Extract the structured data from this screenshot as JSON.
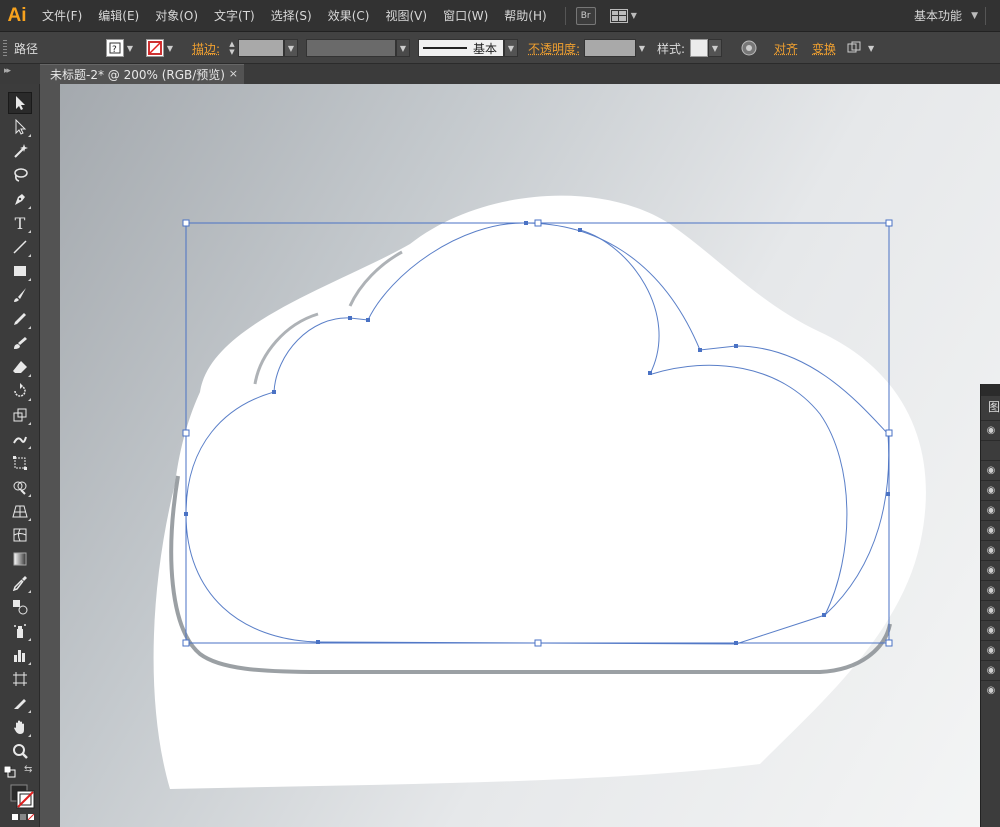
{
  "app": {
    "logo": "Ai"
  },
  "menu": {
    "items": [
      "文件(F)",
      "编辑(E)",
      "对象(O)",
      "文字(T)",
      "选择(S)",
      "效果(C)",
      "视图(V)",
      "窗口(W)",
      "帮助(H)"
    ],
    "bridge": "Br",
    "workspace": "基本功能"
  },
  "control": {
    "object_type": "路径",
    "fill_icon": "question-swatch-icon",
    "stroke_icon": "no-stroke-swatch-icon",
    "stroke_label": "描边:",
    "stroke_profile": "基本",
    "opacity_label": "不透明度:",
    "style_label": "样式:",
    "align_label": "对齐",
    "transform_label": "变换"
  },
  "document": {
    "tab_title": "未标题-2* @ 200% (RGB/预览)",
    "close_glyph": "×"
  },
  "tools": [
    "selection-tool-icon",
    "direct-selection-tool-icon",
    "magic-wand-tool-icon",
    "lasso-tool-icon",
    "pen-tool-icon",
    "type-tool-icon",
    "line-tool-icon",
    "rectangle-tool-icon",
    "paintbrush-tool-icon",
    "pencil-tool-icon",
    "blob-brush-tool-icon",
    "eraser-tool-icon",
    "rotate-tool-icon",
    "scale-tool-icon",
    "warp-tool-icon",
    "free-transform-tool-icon",
    "shape-builder-tool-icon",
    "perspective-grid-tool-icon",
    "mesh-tool-icon",
    "gradient-tool-icon",
    "eyedropper-tool-icon",
    "blend-tool-icon",
    "symbol-sprayer-tool-icon",
    "column-graph-tool-icon",
    "artboard-tool-icon",
    "slice-tool-icon",
    "hand-tool-icon",
    "zoom-tool-icon"
  ],
  "colors": {
    "brand": "#f7a21d",
    "selection": "#4a72c4",
    "menubar": "#323232",
    "panel": "#424242"
  },
  "layers_panel": {
    "tab_glyph": "图"
  }
}
